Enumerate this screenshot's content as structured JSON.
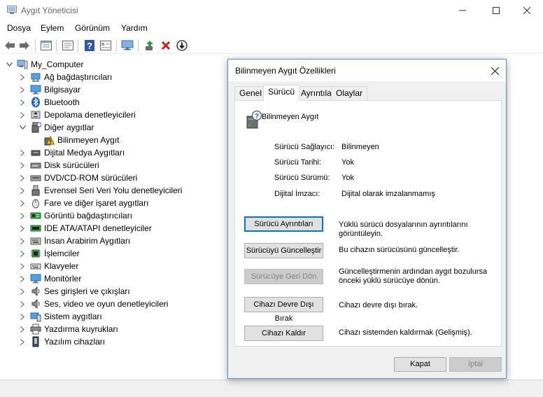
{
  "window": {
    "title": "Aygıt Yöneticisi"
  },
  "menu": [
    "Dosya",
    "Eylem",
    "Görünüm",
    "Yardım"
  ],
  "toolbar": {
    "icons": [
      "back-icon",
      "forward-icon",
      "view-icon",
      "properties-icon",
      "help-icon",
      "view-list-icon",
      "monitor-icon",
      "update-driver-icon",
      "uninstall-icon",
      "disable-icon"
    ]
  },
  "tree": {
    "root": "My_Computer",
    "items": [
      {
        "label": "Ağ bağdaştırıcıları",
        "icon": "network-adapter-icon"
      },
      {
        "label": "Bilgisayar",
        "icon": "computer-icon"
      },
      {
        "label": "Bluetooth",
        "icon": "bluetooth-icon"
      },
      {
        "label": "Depolama denetleyicileri",
        "icon": "storage-controller-icon"
      },
      {
        "label": "Diğer aygıtlar",
        "icon": "other-devices-icon",
        "expanded": true
      },
      {
        "label": "Bilinmeyen Aygıt",
        "icon": "unknown-device-warning-icon",
        "child": true
      },
      {
        "label": "Dijital Medya Aygıtları",
        "icon": "media-device-icon"
      },
      {
        "label": "Disk sürücüleri",
        "icon": "disk-drive-icon"
      },
      {
        "label": "DVD/CD-ROM sürücüleri",
        "icon": "dvd-drive-icon"
      },
      {
        "label": "Evrensel Seri Veri Yolu denetleyicileri",
        "icon": "usb-controller-icon"
      },
      {
        "label": "Fare ve diğer işaret aygıtları",
        "icon": "mouse-icon"
      },
      {
        "label": "Görüntü bağdaştırıcıları",
        "icon": "display-adapter-icon"
      },
      {
        "label": "IDE ATA/ATAPI denetleyiciler",
        "icon": "ide-controller-icon"
      },
      {
        "label": "İnsan Arabirim Aygıtları",
        "icon": "hid-icon"
      },
      {
        "label": "İşlemciler",
        "icon": "processor-icon"
      },
      {
        "label": "Klavyeler",
        "icon": "keyboard-icon"
      },
      {
        "label": "Monitörler",
        "icon": "monitor-icon"
      },
      {
        "label": "Ses girişleri ve çıkışları",
        "icon": "speaker-icon"
      },
      {
        "label": "Ses, video ve oyun denetleyicileri",
        "icon": "audio-controller-icon"
      },
      {
        "label": "Sistem aygıtları",
        "icon": "system-devices-icon"
      },
      {
        "label": "Yazdırma kuyrukları",
        "icon": "printer-queue-icon"
      },
      {
        "label": "Yazılım cihazları",
        "icon": "software-device-icon"
      }
    ]
  },
  "dialog": {
    "title": "Bilinmeyen Aygıt Özellikleri",
    "tabs": [
      "Genel",
      "Sürücü",
      "Ayrıntılar",
      "Olaylar"
    ],
    "active_tab": "Sürücü",
    "device_name": "Bilinmeyen Aygıt",
    "properties": [
      {
        "label": "Sürücü Sağlayıcı:",
        "value": "Bilinmeyen"
      },
      {
        "label": "Sürücü Tarihi:",
        "value": "Yok"
      },
      {
        "label": "Sürücü Sürümü:",
        "value": "Yok"
      },
      {
        "label": "Dijital İmzacı:",
        "value": "Dijital olarak imzalanmamış"
      }
    ],
    "actions": [
      {
        "button": "Sürücü Ayrıntıları",
        "desc": "Yüklü sürücü dosyalarının ayrıntılarını görüntüleyin.",
        "state": "focused"
      },
      {
        "button": "Sürücüyü Güncelleştir",
        "desc": "Bu cihazın sürücüsünü güncelleştir.",
        "state": "enabled"
      },
      {
        "button": "Sürücüye Geri Dön",
        "desc": "Güncelleştirmenin ardından aygıt bozulursa önceki yüklü sürücüye dönün.",
        "state": "disabled"
      },
      {
        "button": "Cihazı Devre Dışı Bırak",
        "desc": "Cihazı devre dışı bırak.",
        "state": "enabled"
      },
      {
        "button": "Cihazı Kaldır",
        "desc": "Cihazı sistemden kaldırmak (Gelişmiş).",
        "state": "enabled"
      }
    ],
    "ok_button": "Kapat",
    "cancel_button": "İptal"
  }
}
